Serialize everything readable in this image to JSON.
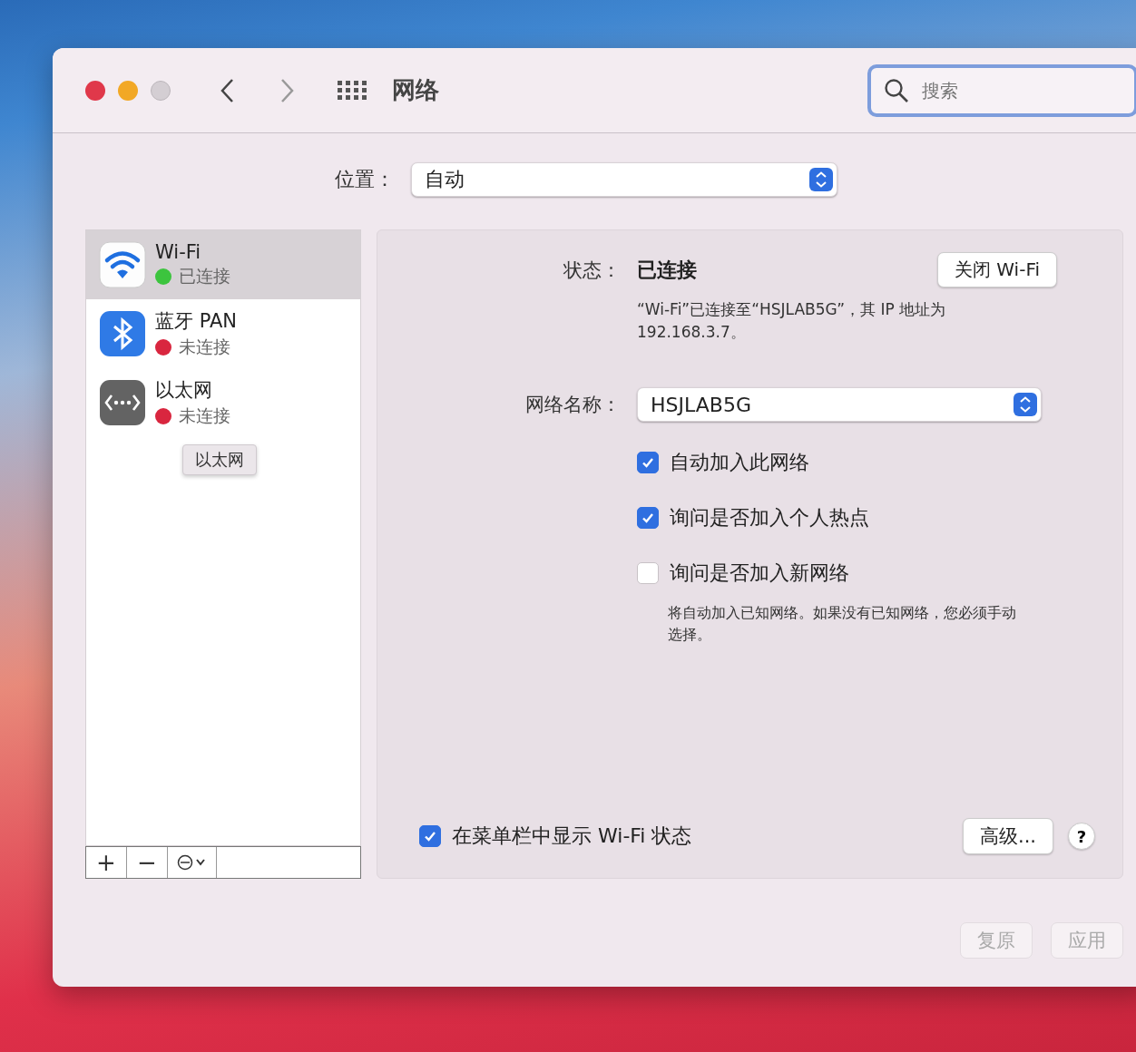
{
  "window": {
    "title": "网络"
  },
  "search": {
    "placeholder": "搜索"
  },
  "location": {
    "label": "位置：",
    "value": "自动"
  },
  "services": [
    {
      "name": "Wi-Fi",
      "status": "已连接",
      "color": "#3cc43e",
      "kind": "wifi",
      "selected": true
    },
    {
      "name": "蓝牙 PAN",
      "status": "未连接",
      "color": "#d9263f",
      "kind": "bluetooth",
      "selected": false
    },
    {
      "name": "以太网",
      "status": "未连接",
      "color": "#d9263f",
      "kind": "ethernet",
      "selected": false
    }
  ],
  "tooltip": "以太网",
  "sidebar_toolbar": [
    "+",
    "−"
  ],
  "detail": {
    "status_label": "状态：",
    "status": "已连接",
    "toggle_button": "关闭 Wi-Fi",
    "description": "“Wi-Fi”已连接至“HSJLAB5G”，其 IP 地址为 192.168.3.7。",
    "network_label": "网络名称：",
    "network_value": "HSJLAB5G",
    "options": [
      {
        "label": "自动加入此网络",
        "checked": true
      },
      {
        "label": "询问是否加入个人热点",
        "checked": true
      },
      {
        "label": "询问是否加入新网络",
        "checked": false
      }
    ],
    "note": "将自动加入已知网络。如果没有已知网络，您必须手动选择。",
    "menubar": {
      "label": "在菜单栏中显示 Wi-Fi 状态",
      "checked": true
    },
    "advanced": "高级...",
    "help": "?"
  },
  "footer_buttons": [
    {
      "label": "复原",
      "disabled": true
    },
    {
      "label": "应用",
      "disabled": true
    }
  ]
}
